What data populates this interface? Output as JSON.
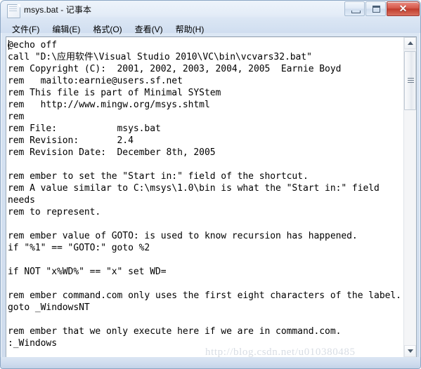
{
  "window": {
    "title": "msys.bat - 记事本",
    "icon": "notepad-icon"
  },
  "window_controls": {
    "minimize_label": "—",
    "maximize_label": "❐",
    "close_label": "✕"
  },
  "menu": {
    "items": [
      {
        "label": "文件(F)"
      },
      {
        "label": "编辑(E)"
      },
      {
        "label": "格式(O)"
      },
      {
        "label": "查看(V)"
      },
      {
        "label": "帮助(H)"
      }
    ]
  },
  "editor": {
    "content": "@echo off\ncall \"D:\\应用软件\\Visual Studio 2010\\VC\\bin\\vcvars32.bat\"\nrem Copyright (C):  2001, 2002, 2003, 2004, 2005  Earnie Boyd\nrem   mailto:earnie@users.sf.net\nrem This file is part of Minimal SYStem\nrem   http://www.mingw.org/msys.shtml\nrem\nrem File:           msys.bat\nrem Revision:       2.4\nrem Revision Date:  December 8th, 2005\n\nrem ember to set the \"Start in:\" field of the shortcut.\nrem A value similar to C:\\msys\\1.0\\bin is what the \"Start in:\" field needs\nrem to represent.\n\nrem ember value of GOTO: is used to know recursion has happened.\nif \"%1\" == \"GOTO:\" goto %2\n\nif NOT \"x%WD%\" == \"x\" set WD=\n\nrem ember command.com only uses the first eight characters of the label.\ngoto _WindowsNT\n\nrem ember that we only execute here if we are in command.com.\n:_Windows"
  },
  "scrollbar": {
    "up_arrow": "scroll-up-arrow",
    "down_arrow": "scroll-down-arrow",
    "thumb": "scroll-thumb"
  },
  "watermark": {
    "text": "http://blog.csdn.net/u010380485"
  },
  "colors": {
    "frame": "#d4e1f1",
    "close_button": "#c03d2d",
    "client_background": "#ffffff",
    "text": "#000000",
    "watermark": "#d8dde4"
  }
}
